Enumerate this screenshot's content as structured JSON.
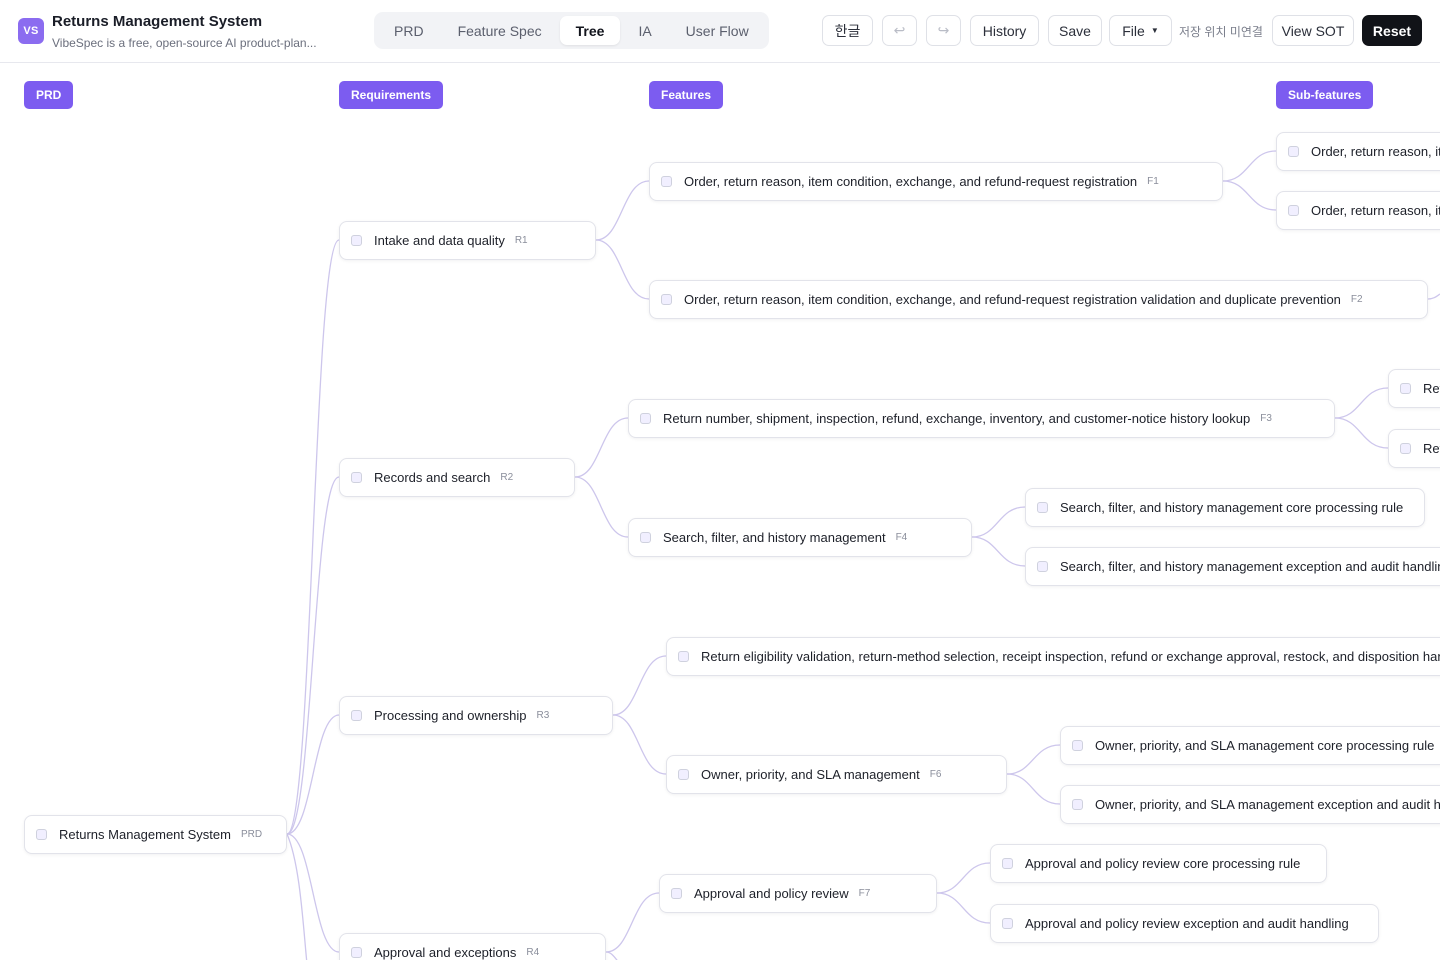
{
  "app": {
    "logo": "VS",
    "title": "Returns Management System",
    "subtitle": "VibeSpec is a free, open-source AI product-plan..."
  },
  "tabs": [
    {
      "label": "PRD",
      "active": false
    },
    {
      "label": "Feature Spec",
      "active": false
    },
    {
      "label": "Tree",
      "active": true
    },
    {
      "label": "IA",
      "active": false
    },
    {
      "label": "User Flow",
      "active": false
    }
  ],
  "toolbar": {
    "lang_label": "한글",
    "undo_icon": "↩",
    "redo_icon": "↪",
    "history_label": "History",
    "save_label": "Save",
    "file_label": "File",
    "save_hint": "저장 위치 미연결",
    "view_sot_label": "View SOT",
    "reset_label": "Reset"
  },
  "columns": {
    "prd": "PRD",
    "requirements": "Requirements",
    "features": "Features",
    "subfeatures": "Sub-features"
  },
  "root": {
    "label": "Returns Management System",
    "tag": "PRD"
  },
  "requirements": [
    {
      "label": "Intake and data quality",
      "tag": "R1"
    },
    {
      "label": "Records and search",
      "tag": "R2"
    },
    {
      "label": "Processing and ownership",
      "tag": "R3"
    },
    {
      "label": "Approval and exceptions",
      "tag": "R4"
    }
  ],
  "features": [
    {
      "label": "Order, return reason, item condition, exchange, and refund-request registration",
      "tag": "F1"
    },
    {
      "label": "Order, return reason, item condition, exchange, and refund-request registration validation and duplicate prevention",
      "tag": "F2"
    },
    {
      "label": "Return number, shipment, inspection, refund, exchange, inventory, and customer-notice history lookup",
      "tag": "F3"
    },
    {
      "label": "Search, filter, and history management",
      "tag": "F4"
    },
    {
      "label": "Return eligibility validation, return-method selection, receipt inspection, refund or exchange approval, restock, and disposition handling",
      "tag": ""
    },
    {
      "label": "Owner, priority, and SLA management",
      "tag": "F6"
    },
    {
      "label": "Approval and policy review",
      "tag": "F7"
    }
  ],
  "subfeatures": [
    {
      "label": "Order, return reason, item condition, exchange, and refund-request registration core processing rule"
    },
    {
      "label": "Order, return reason, item condition, exchange, and refund-request registration exception and audit handling"
    },
    {
      "label": "Return number, shipment, inspection, refund, exchange, inventory, and customer-notice history lookup core processing rule"
    },
    {
      "label": "Return number, shipment, inspection, refund, exchange, inventory, and customer-notice history lookup exception and audit handling"
    },
    {
      "label": "Search, filter, and history management core processing rule"
    },
    {
      "label": "Search, filter, and history management exception and audit handling"
    },
    {
      "label": "Owner, priority, and SLA management core processing rule"
    },
    {
      "label": "Owner, priority, and SLA management exception and audit handling"
    },
    {
      "label": "Approval and policy review core processing rule"
    },
    {
      "label": "Approval and policy review exception and audit handling"
    }
  ]
}
